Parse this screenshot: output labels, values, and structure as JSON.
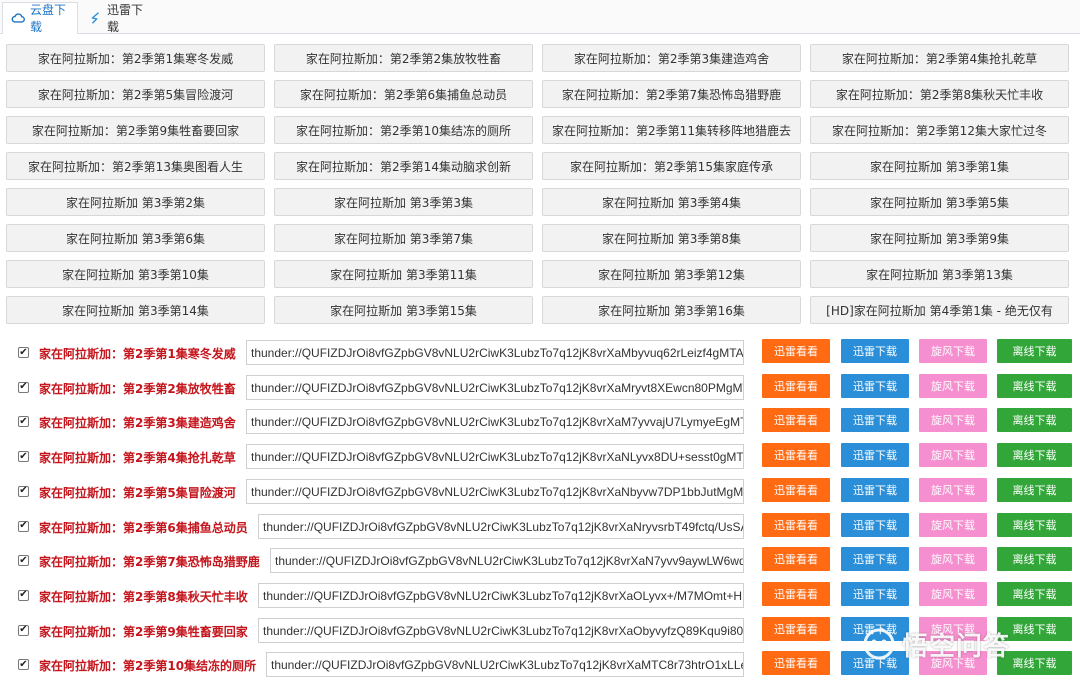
{
  "tabs": [
    {
      "label": "云盘下载",
      "icon": "cloud-icon",
      "active": true
    },
    {
      "label": "迅雷下载",
      "icon": "thunder-icon",
      "active": false
    }
  ],
  "episodes": [
    "家在阿拉斯加：第2季第1集寒冬发威",
    "家在阿拉斯加：第2季第2集放牧牲畜",
    "家在阿拉斯加：第2季第3集建造鸡舍",
    "家在阿拉斯加：第2季第4集抢扎乾草",
    "家在阿拉斯加：第2季第5集冒险渡河",
    "家在阿拉斯加：第2季第6集捕鱼总动员",
    "家在阿拉斯加：第2季第7集恐怖岛猎野鹿",
    "家在阿拉斯加：第2季第8集秋天忙丰收",
    "家在阿拉斯加：第2季第9集牲畜要回家",
    "家在阿拉斯加：第2季第10集结冻的厕所",
    "家在阿拉斯加：第2季第11集转移阵地猎鹿去",
    "家在阿拉斯加：第2季第12集大家忙过冬",
    "家在阿拉斯加：第2季第13集奥图看人生",
    "家在阿拉斯加：第2季第14集动脑求创新",
    "家在阿拉斯加：第2季第15集家庭传承",
    "家在阿拉斯加 第3季第1集",
    "家在阿拉斯加 第3季第2集",
    "家在阿拉斯加 第3季第3集",
    "家在阿拉斯加 第3季第4集",
    "家在阿拉斯加 第3季第5集",
    "家在阿拉斯加 第3季第6集",
    "家在阿拉斯加 第3季第7集",
    "家在阿拉斯加 第3季第8集",
    "家在阿拉斯加 第3季第9集",
    "家在阿拉斯加 第3季第10集",
    "家在阿拉斯加 第3季第11集",
    "家在阿拉斯加 第3季第12集",
    "家在阿拉斯加 第3季第13集",
    "家在阿拉斯加 第3季第14集",
    "家在阿拉斯加 第3季第15集",
    "家在阿拉斯加 第3季第16集",
    "[HD]家在阿拉斯加 第4季第1集 - 绝无仅有"
  ],
  "buttons": {
    "watch": "迅雷看看",
    "xunlei": "迅雷下载",
    "xuanfeng": "旋风下载",
    "offline": "离线下载"
  },
  "downloads": [
    {
      "checked": true,
      "name": "家在阿拉斯加：第2季第1集寒冬发威",
      "link": "thunder://QUFIZDJrOi8vfGZpbGV8vNLU2rCiwK3LubzTo7q12jK8vrXaMbyvuq62rLeizf4gMTA4..."
    },
    {
      "checked": true,
      "name": "家在阿拉斯加：第2季第2集放牧牲畜",
      "link": "thunder://QUFIZDJrOi8vfGZpbGV8vNLU2rCiwK3LubzTo7q12jK8vrXaMryvt8XEwcn80PMgMT..."
    },
    {
      "checked": true,
      "name": "家在阿拉斯加：第2季第3集建造鸡舍",
      "link": "thunder://QUFIZDJrOi8vfGZpbGV8vNLU2rCiwK3LubzTo7q12jK8vrXaM7yvvajU7LymyeEgMT..."
    },
    {
      "checked": true,
      "name": "家在阿拉斯加：第2季第4集抢扎乾草",
      "link": "thunder://QUFIZDJrOi8vfGZpbGV8vNLU2rCiwK3LubzTo7q12jK8vrXaNLyvx8DU+sesst0gMTA..."
    },
    {
      "checked": true,
      "name": "家在阿拉斯加：第2季第5集冒险渡河",
      "link": "thunder://QUFIZDJrOi8vfGZpbGV8vNLU2rCiwK3LubzTo7q12jK8vrXaNbyvw7DP1bbJutMgMT..."
    },
    {
      "checked": true,
      "name": "家在阿拉斯加：第2季第6集捕鱼总动员",
      "link": "thunder://QUFIZDJrOi8vfGZpbGV8vNLU2rCiwK3LubzTo7q12jK8vrXaNryvsrbT49fctq/UsSA..."
    },
    {
      "checked": true,
      "name": "家在阿拉斯加：第2季第7集恐怖岛猎野鹿",
      "link": "thunder://QUFIZDJrOi8vfGZpbGV8vNLU2rCiwK3LubzTo7q12jK8vrXaN7yvv9aywLW6wd..."
    },
    {
      "checked": true,
      "name": "家在阿拉斯加：第2季第8集秋天忙丰收",
      "link": "thunder://QUFIZDJrOi8vfGZpbGV8vNLU2rCiwK3LubzTo7q12jK8vrXaOLyvx+/M7MOmt+HK..."
    },
    {
      "checked": true,
      "name": "家在阿拉斯加：第2季第9集牲畜要回家",
      "link": "thunder://QUFIZDJrOi8vfGZpbGV8vNLU2rCiwK3LubzTo7q12jK8vrXaObyvyfzQ89Kqu9i80i..."
    },
    {
      "checked": true,
      "name": "家在阿拉斯加：第2季第10集结冻的厕所",
      "link": "thunder://QUFIZDJrOi8vfGZpbGV8vNLU2rCiwK3LubzTo7q12jK8vrXaMTC8r73htrO1xLLe..."
    }
  ],
  "watermark": "悟空问答"
}
